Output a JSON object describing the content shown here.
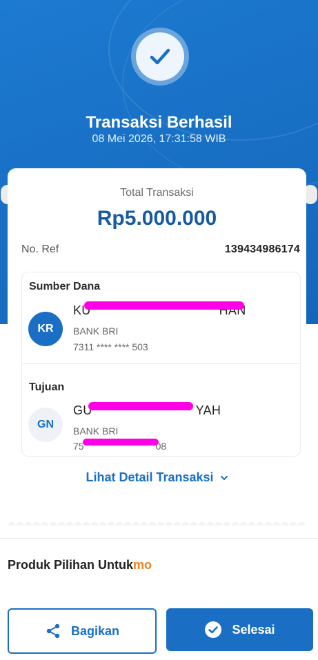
{
  "header": {
    "title": "Transaksi Berhasil",
    "datetime": "08 Mei 2026, 17:31:58 WIB"
  },
  "summary": {
    "total_label": "Total Transaksi",
    "total_amount": "Rp5.000.000",
    "ref_label": "No. Ref",
    "ref_value": "139434986174"
  },
  "source": {
    "section_label": "Sumber Dana",
    "initials": "KR",
    "name_prefix": "KU",
    "name_suffix": "HAN",
    "bank": "BANK BRI",
    "account": "7311 **** **** 503"
  },
  "destination": {
    "section_label": "Tujuan",
    "initials": "GN",
    "name_prefix": "GU",
    "name_suffix": "YAH",
    "bank": "BANK BRI",
    "account_prefix": "75",
    "account_suffix": "08"
  },
  "detail_link": "Lihat Detail Transaksi",
  "promo": {
    "title": "Produk Pilihan Untuk",
    "brand": "mo"
  },
  "actions": {
    "share_label": "Bagikan",
    "done_label": "Selesai"
  },
  "colors": {
    "primary": "#1a6fc4",
    "amount": "#175a9f",
    "brand_orange": "#f07f1e",
    "redaction": "#ff00e6"
  },
  "icons": [
    "check-icon",
    "chevron-down-icon",
    "share-icon",
    "check-circle-icon"
  ]
}
